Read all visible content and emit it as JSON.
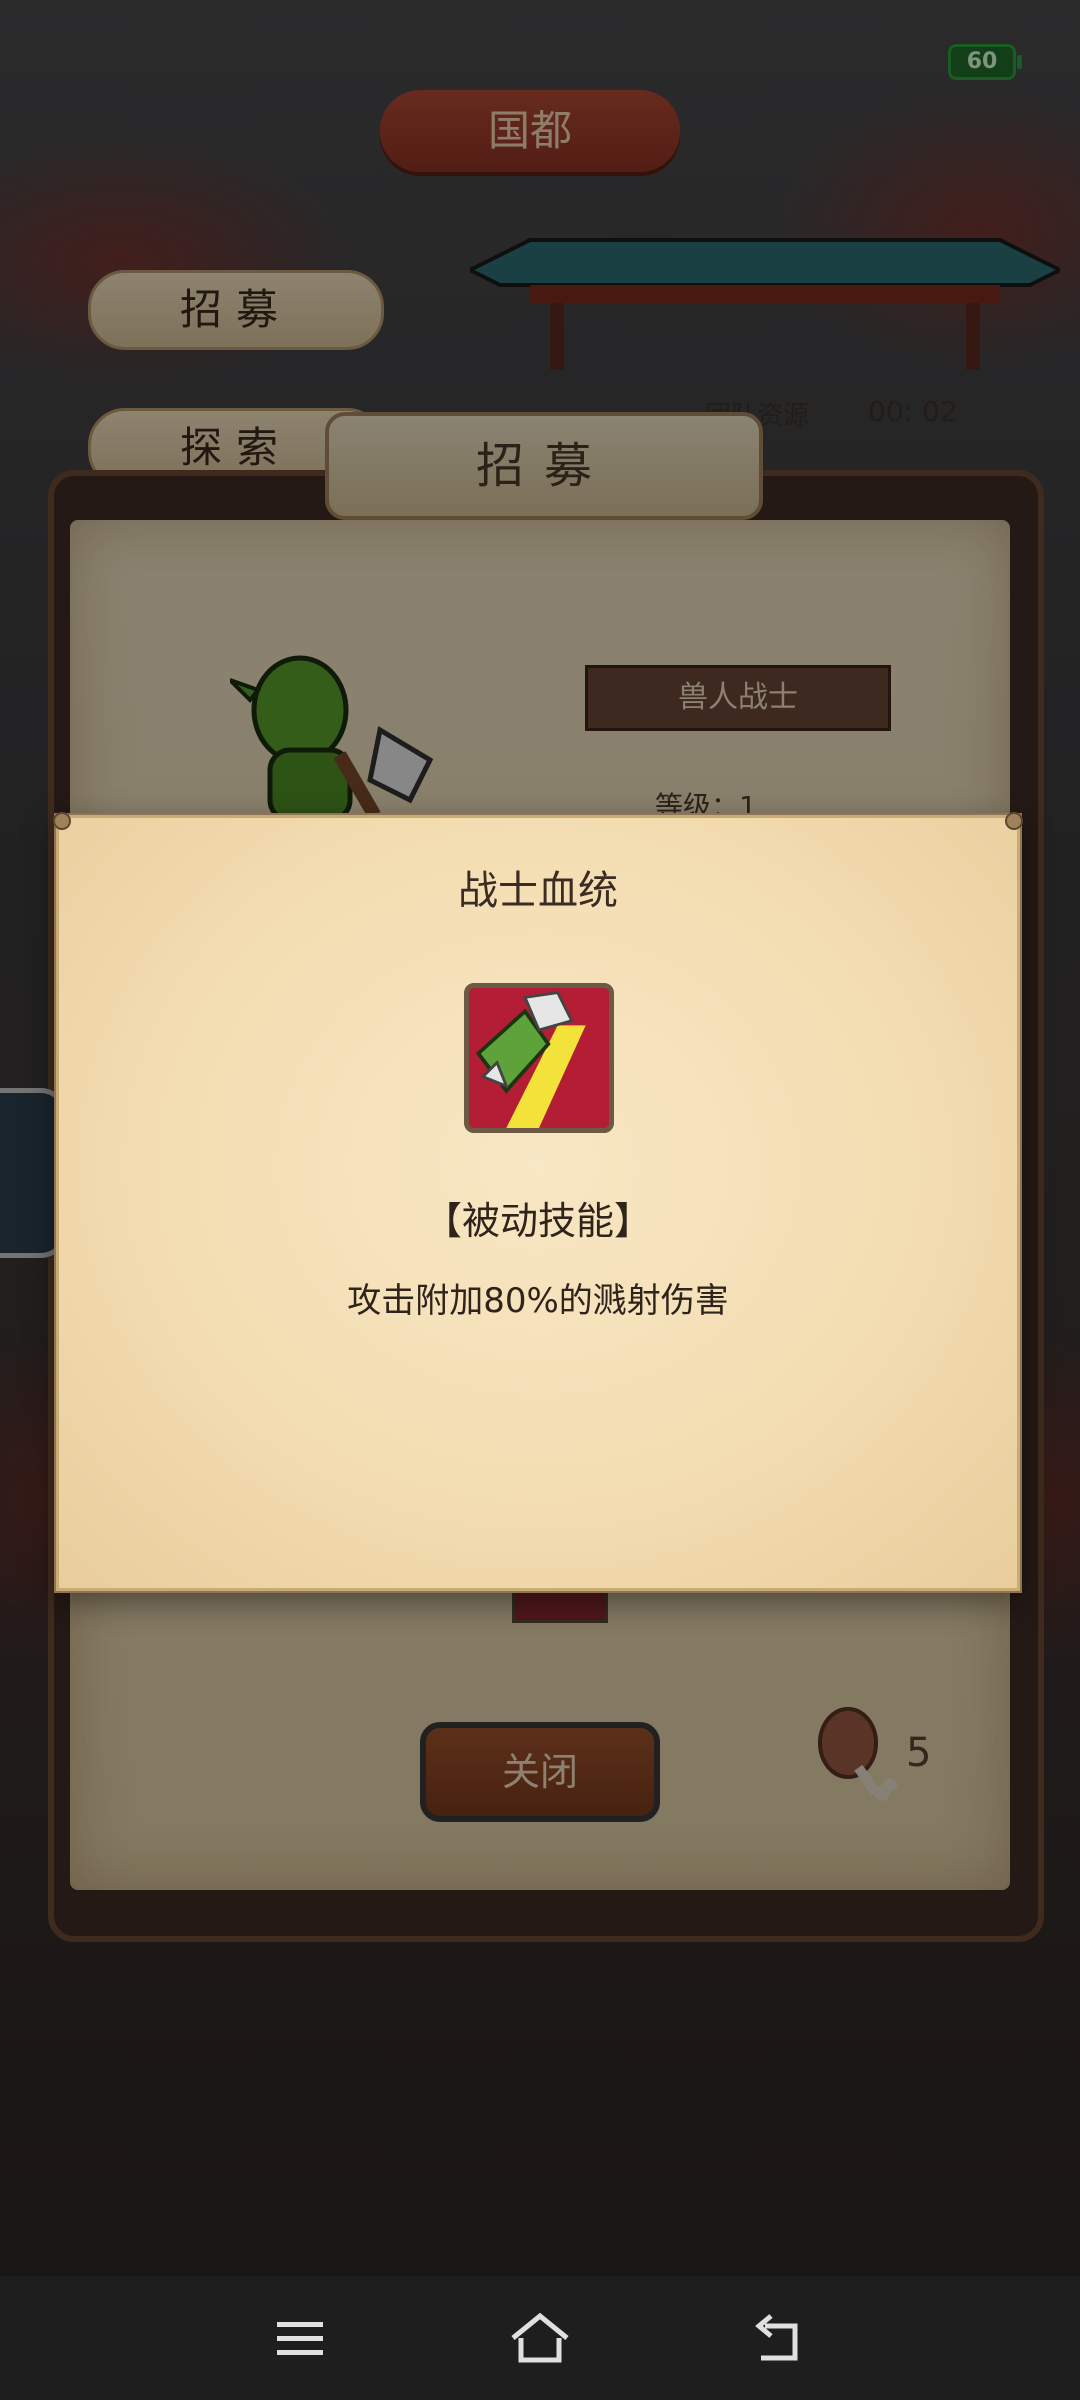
{
  "status": {
    "battery": "60"
  },
  "header": {
    "capital": "国都"
  },
  "side_menu": {
    "recruit": "招募",
    "explore": "探索"
  },
  "resources": {
    "label": "团队资源",
    "timer": "00: 02"
  },
  "recruit_panel": {
    "title": "招募",
    "unit_name": "兽人战士",
    "level_label": "等级：1",
    "close_label": "关闭",
    "meat_count": "5"
  },
  "modal": {
    "title": "战士血统",
    "skill_type": "【被动技能】",
    "skill_description": "攻击附加80%的溅射伤害",
    "icon": "green-axe-skill-icon"
  },
  "navbar": {
    "icons": [
      "menu-icon",
      "home-icon",
      "back-icon"
    ]
  },
  "colors": {
    "modal_bg": "#f3ddb2",
    "close_button": "#8e4424",
    "skill_icon_bg": "#b31e35"
  }
}
